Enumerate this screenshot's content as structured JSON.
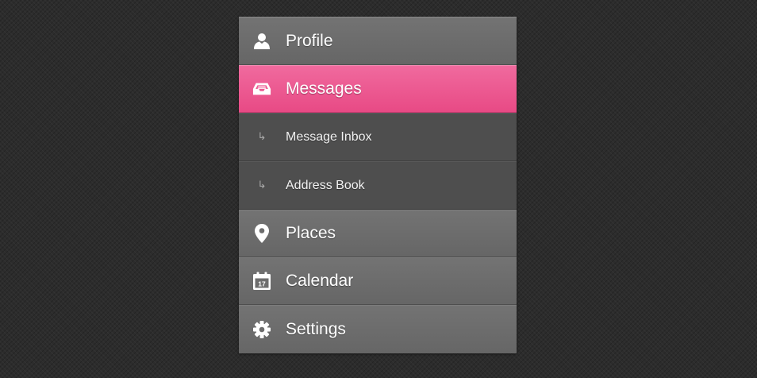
{
  "colors": {
    "background": "#2c2c2c",
    "item": "#6d6d6d",
    "active": "#ec5a92",
    "submenu": "#4e4e4e",
    "text": "#ffffff"
  },
  "menu": {
    "items": [
      {
        "label": "Profile",
        "icon": "user-icon",
        "active": false
      },
      {
        "label": "Messages",
        "icon": "inbox-icon",
        "active": true,
        "subitems": [
          {
            "label": "Message Inbox",
            "icon": "subitem-arrow-icon",
            "glyph": "↳"
          },
          {
            "label": "Address Book",
            "icon": "subitem-arrow-icon",
            "glyph": "↳"
          }
        ]
      },
      {
        "label": "Places",
        "icon": "map-pin-icon",
        "active": false
      },
      {
        "label": "Calendar",
        "icon": "calendar-icon",
        "active": false,
        "icon_text": "17"
      },
      {
        "label": "Settings",
        "icon": "gear-icon",
        "active": false
      }
    ]
  }
}
